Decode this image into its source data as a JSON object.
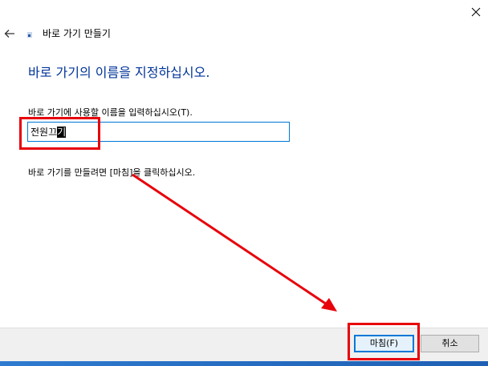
{
  "window": {
    "close_icon": "close-icon",
    "back_icon": "back-arrow-icon",
    "wizard_icon": "shortcut-wizard-icon",
    "title": "바로 가기 만들기"
  },
  "content": {
    "heading": "바로 가기의 이름을 지정하십시오.",
    "input_label": "바로 가기에 사용할 이름을 입력하십시오(T).",
    "input_value_plain": "전원끄",
    "input_value_selected": "기",
    "finish_hint": "바로 가기를 만들려면 [마침]을 클릭하십시오."
  },
  "footer": {
    "finish_label": "마침(F)",
    "cancel_label": "취소"
  },
  "colors": {
    "heading": "#003399",
    "accent": "#0078d7",
    "annotation": "#e8000b",
    "footer_bg": "#f0f0f0"
  }
}
